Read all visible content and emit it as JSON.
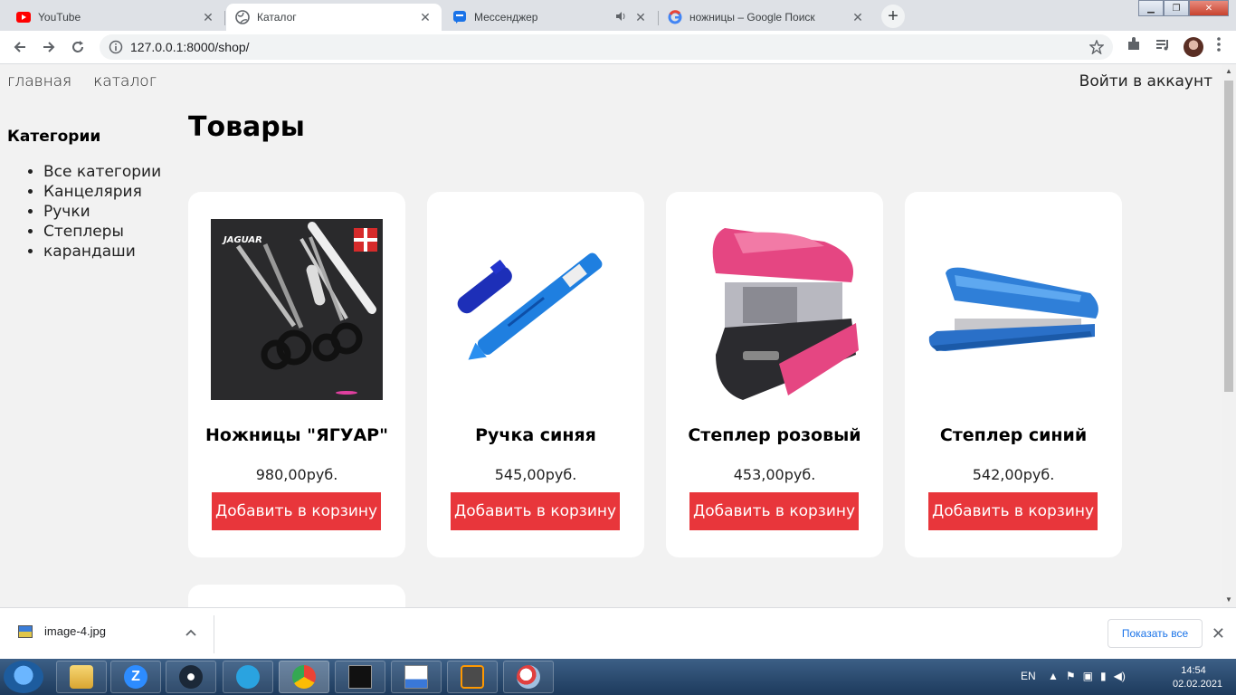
{
  "browser": {
    "tabs": [
      {
        "title": "YouTube",
        "icon": "youtube-icon",
        "active": false
      },
      {
        "title": "Каталог",
        "icon": "globe-icon",
        "active": true
      },
      {
        "title": "Мессенджер",
        "icon": "messenger-icon",
        "active": false
      },
      {
        "title": "ножницы – Google Поиск",
        "icon": "google-icon",
        "active": false
      }
    ],
    "url": "127.0.0.1:8000/shop/"
  },
  "site": {
    "nav": {
      "home": "главная",
      "catalog": "каталог"
    },
    "login": "Войти в аккаунт",
    "sidebar": {
      "title": "Категории",
      "items": [
        "Все категории",
        "Канцелярия",
        "Ручки",
        "Степлеры",
        "карандаши"
      ]
    },
    "page_title": "Товары",
    "products": [
      {
        "name": "Ножницы \"ЯГУАР\"",
        "price": "980,00руб.",
        "button": "Добавить в корзину",
        "image": "scissors-image",
        "image_text": "JAGUAR"
      },
      {
        "name": "Ручка синяя",
        "price": "545,00руб.",
        "button": "Добавить в корзину",
        "image": "blue-pen-image"
      },
      {
        "name": "Степлер розовый",
        "price": "453,00руб.",
        "button": "Добавить в корзину",
        "image": "pink-stapler-image"
      },
      {
        "name": "Степлер синий",
        "price": "542,00руб.",
        "button": "Добавить в корзину",
        "image": "blue-stapler-image"
      }
    ]
  },
  "downloads": {
    "file": "image-4.jpg",
    "show_all": "Показать все"
  },
  "taskbar": {
    "lang": "EN",
    "time": "14:54",
    "date": "02.02.2021"
  },
  "colors": {
    "accent_button": "#e8363b",
    "page_bg": "#f2f2f2",
    "card_bg": "#ffffff"
  }
}
